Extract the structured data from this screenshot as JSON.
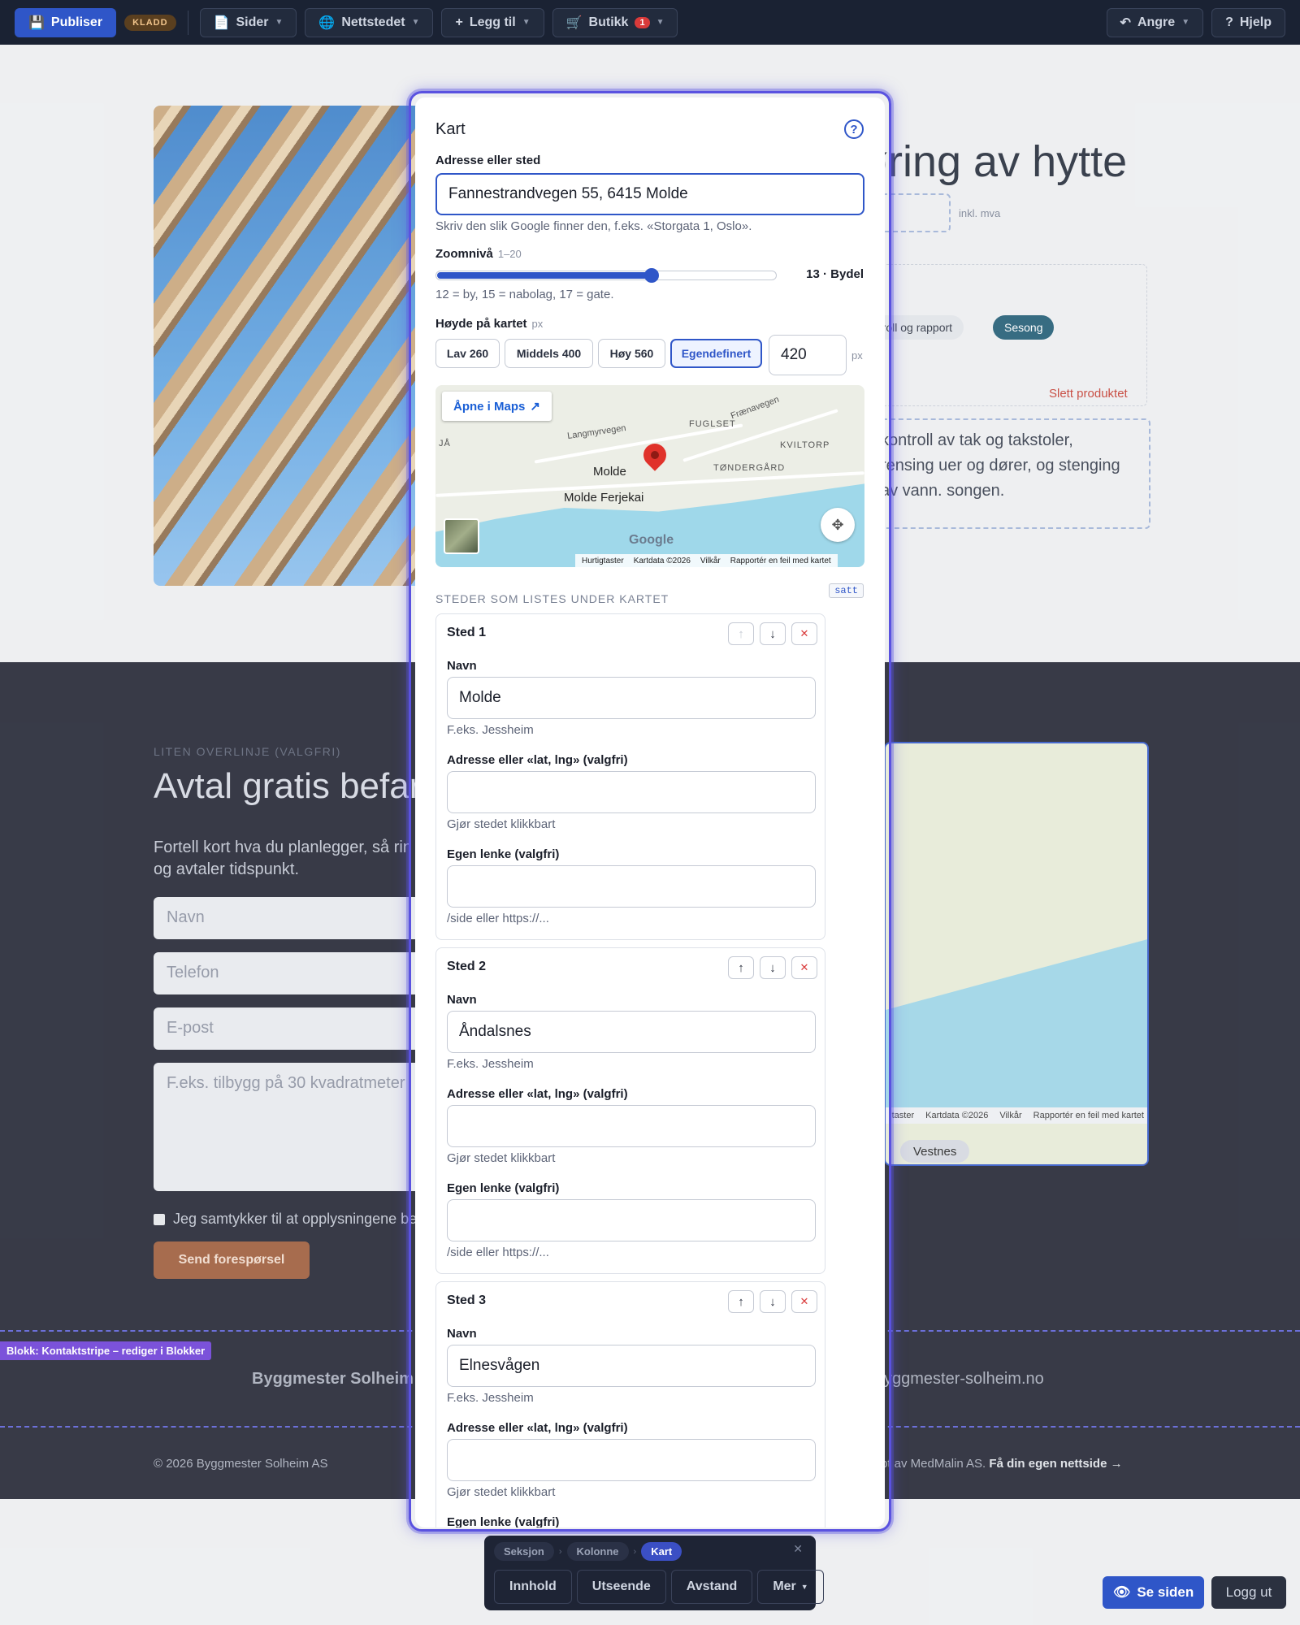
{
  "toolbar": {
    "publish": "Publiser",
    "draft_badge": "KLADD",
    "pages": "Sider",
    "website": "Nettstedet",
    "add": "Legg til",
    "shop": "Butikk",
    "shop_count": "1",
    "undo": "Angre",
    "help": "Hjelp"
  },
  "page": {
    "hero_title": "øring av hytte",
    "price_note": "inkl. mva",
    "pill_1": "ntroll og rapport",
    "pill_2": "Sesong",
    "delete_product": "Slett produktet",
    "description": "kontroll av tak og takstoler, rensing uer og dører, og stenging av vann. songen.",
    "overline": "LITEN OVERLINJE (VALGFRI)",
    "contact_title": "Avtal gratis befar",
    "contact_lead": "Fortell kort hva du planlegger, så rin og avtaler tidspunkt.",
    "field_name": "Navn",
    "field_phone": "Telefon",
    "field_email": "E-post",
    "field_message": "F.eks. tilbygg på 30 kvadratmeter",
    "consent": "Jeg samtykker til at opplysningene beh",
    "send": "Send forespørsel",
    "place_pill": "Vestnes",
    "map_shortcuts": "taster",
    "map_data": "Kartdata ©2026",
    "map_terms": "Vilkår",
    "map_report": "Rapportér en feil med kartet",
    "block_label": "Blokk: Kontaktstripe – rediger i Blokker",
    "company": "Byggmester Solheim A",
    "website_url": "yggmester-solheim.no",
    "copyright": "© 2026 Byggmester Solheim AS",
    "made_by_prefix": "pt av MedMalin AS.",
    "made_by_link": "Få din egen nettside →"
  },
  "modal": {
    "title": "Kart",
    "address_label": "Adresse eller sted",
    "address_value": "Fannestrandvegen 55, 6415 Molde",
    "address_help": "Skriv den slik Google finner den, f.eks. «Storgata 1, Oslo».",
    "zoom_label": "Zoomnivå",
    "zoom_range": "1–20",
    "zoom_value": 13,
    "zoom_min": 1,
    "zoom_max": 20,
    "zoom_display": "13 · Bydel",
    "zoom_help": "12 = by, 15 = nabolag, 17 = gate.",
    "height_label": "Høyde på kartet",
    "height_unit": "px",
    "height_options": [
      "Lav 260",
      "Middels 400",
      "Høy 560",
      "Egendefinert"
    ],
    "height_value": "420",
    "map": {
      "open_maps": "Åpne i Maps",
      "labels": [
        "FUGLSET",
        "KVILTORP",
        "TØNDERGÅRD",
        "Langmyrvegen",
        "Frænavegen",
        "Molde",
        "Molde Ferjekai",
        "JÅ"
      ],
      "shortcuts": "Hurtigtaster",
      "data": "Kartdata ©2026",
      "terms": "Vilkår",
      "report": "Rapportér en feil med kartet",
      "google": "Google"
    },
    "places_heading": "STEDER SOM LISTES UNDER KARTET",
    "satt_badge": "satt",
    "name_label": "Navn",
    "name_help": "F.eks. Jessheim",
    "addr_label": "Adresse eller «lat, lng» (valgfri)",
    "addr_help": "Gjør stedet klikkbart",
    "link_label": "Egen lenke (valgfri)",
    "link_help": "/side eller https://...",
    "places": [
      {
        "title": "Sted 1",
        "name": "Molde"
      },
      {
        "title": "Sted 2",
        "name": "Åndalsnes"
      },
      {
        "title": "Sted 3",
        "name": "Elnesvågen"
      }
    ]
  },
  "bottom_bar": {
    "crumbs": [
      "Seksjon",
      "Kolonne",
      "Kart"
    ],
    "tabs": [
      "Innhold",
      "Utseende",
      "Avstand",
      "Mer"
    ],
    "see_site": "Se siden",
    "logout": "Logg ut"
  },
  "colors": {
    "accent": "#2f56c8",
    "modal_glow": "#5a52e0",
    "dark_section": "#1f2230",
    "danger": "#d93a3a"
  }
}
